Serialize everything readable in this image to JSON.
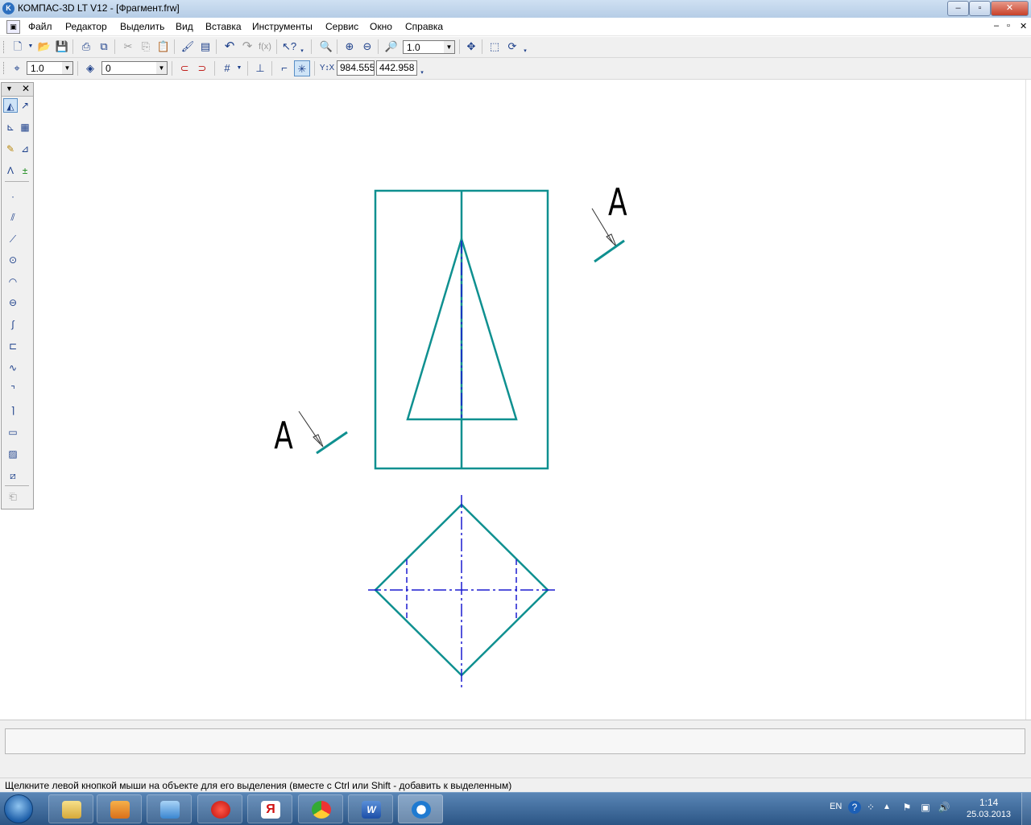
{
  "window": {
    "title": "КОМПАС-3D LT V12 - [Фрагмент.frw]",
    "app_icon_letter": "K",
    "controls": [
      "–",
      "▫",
      "✕"
    ]
  },
  "menu": {
    "items": [
      "Файл",
      "Редактор",
      "Выделить",
      "Вид",
      "Вставка",
      "Инструменты",
      "Сервис",
      "Окно",
      "Справка"
    ],
    "mdi_controls": [
      "–",
      "▫",
      "✕"
    ]
  },
  "toolbar1": {
    "zoom_value": "1.0"
  },
  "toolbar2": {
    "step_value": "1.0",
    "layer_value": "0",
    "coord_x": "984.555",
    "coord_y": "442.958"
  },
  "drawing": {
    "label_top": "A",
    "label_left": "A",
    "line_color": "#0f9090",
    "axis_color": "#1b1bd0"
  },
  "status": {
    "hint": "Щелкните левой кнопкой мыши на объекте для его выделения (вместе с Ctrl или Shift - добавить к выделенным)"
  },
  "taskbar": {
    "apps": [
      "explorer",
      "media-player",
      "mail",
      "opera",
      "yandex",
      "chrome",
      "word",
      "kompas"
    ],
    "language": "EN",
    "time": "1:14",
    "date": "25.03.2013"
  }
}
